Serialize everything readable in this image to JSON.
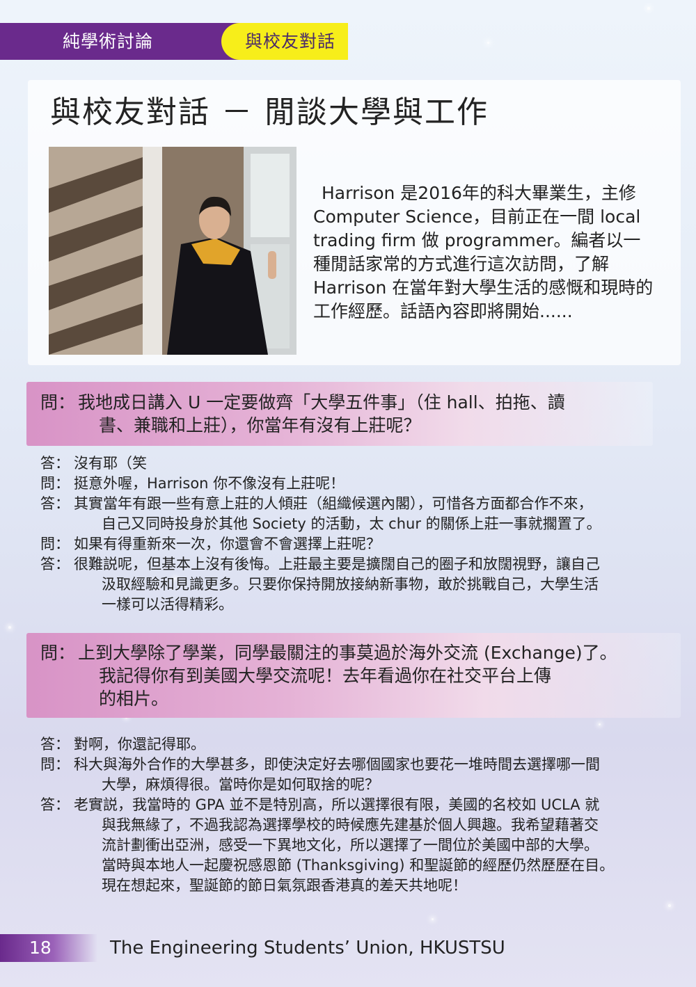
{
  "header": {
    "section": "純學術討論",
    "tab": "與校友對話"
  },
  "title": "與校友對話 － 閒談大學與工作",
  "intro": "Harrison 是2016年的科大畢業生，主修 Computer Science，目前正在一間 local trading firm 做 programmer。編者以一種閒話家常的方式進行這次訪問，了解 Harrison 在當年對大學生活的感慨和現時的工作經歷。話語內容即將開始......",
  "q_label": "問：",
  "a_label": "答：",
  "q1": {
    "line1": "我地成日講入 U 一定要做齊「大學五件事」（住 hall、拍拖、讀",
    "line2": "書、兼職和上莊），你當年有沒有上莊呢？"
  },
  "dialogue1": [
    {
      "label": "答：",
      "text": "沒有耶（笑",
      "cont": ""
    },
    {
      "label": "問：",
      "text": "挺意外喔，Harrison 你不像沒有上莊呢！",
      "cont": ""
    },
    {
      "label": "答：",
      "text": "其實當年有跟一些有意上莊的人傾莊（組織候選內閣），可惜各方面都合作不來，",
      "cont": "自己又同時投身於其他 Society 的活動，太 chur 的關係上莊一事就擱置了。"
    },
    {
      "label": "問：",
      "text": "如果有得重新來一次，你還會不會選擇上莊呢？",
      "cont": ""
    },
    {
      "label": "答：",
      "text": "很難説呢，但基本上沒有後悔。上莊最主要是擴闊自己的圈子和放闊視野，讓自己",
      "cont": "汲取經驗和見識更多。只要你保持開放接納新事物，敢於挑戰自己，大學生活",
      "cont2": "一樣可以活得精彩。"
    }
  ],
  "q2": {
    "line1": "上到大學除了學業，同學最關注的事莫過於海外交流 (Exchange)了。",
    "line2": "我記得你有到美國大學交流呢！去年看過你在社交平台上傳",
    "line3": "的相片。"
  },
  "dialogue2": [
    {
      "label": "答：",
      "text": "對啊，你還記得耶。"
    },
    {
      "label": "問：",
      "text": "科大與海外合作的大學甚多，即使決定好去哪個國家也要花一堆時間去選擇哪一間",
      "cont": "大學，麻煩得很。當時你是如何取捨的呢？"
    },
    {
      "label": "答：",
      "text": "老實説，我當時的 GPA 並不是特別高，所以選擇很有限，美國的名校如 UCLA 就",
      "cont": "與我無緣了，不過我認為選擇學校的時候應先建基於個人興趣。我希望藉著交",
      "cont2": "流計劃衝出亞洲，感受一下異地文化，所以選擇了一間位於美國中部的大學。",
      "cont3": "當時與本地人一起慶祝感恩節 (Thanksgiving) 和聖誕節的經歷仍然歷歷在目。",
      "cont4": "現在想起來，聖誕節的節日氣氛跟香港真的差天共地呢！"
    }
  ],
  "footer": {
    "page": "18",
    "org": "The Engineering Students’ Union, HKUSTSU"
  }
}
